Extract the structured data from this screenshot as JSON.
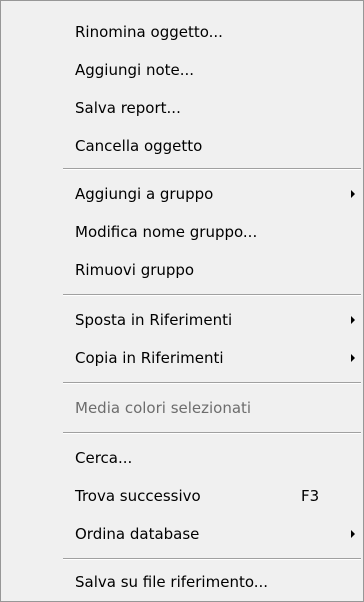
{
  "menu": {
    "items": [
      {
        "label": "Rinomina oggetto..."
      },
      {
        "label": "Aggiungi note..."
      },
      {
        "label": "Salva report..."
      },
      {
        "label": "Cancella oggetto"
      },
      {
        "label": "Aggiungi a gruppo",
        "submenu": true
      },
      {
        "label": "Modifica nome gruppo..."
      },
      {
        "label": "Rimuovi gruppo"
      },
      {
        "label": "Sposta in Riferimenti",
        "submenu": true
      },
      {
        "label": "Copia in Riferimenti",
        "submenu": true
      },
      {
        "label": "Media colori selezionati",
        "disabled": true
      },
      {
        "label": "Cerca..."
      },
      {
        "label": "Trova successivo",
        "shortcut": "F3"
      },
      {
        "label": "Ordina database",
        "submenu": true
      },
      {
        "label": "Salva su file riferimento..."
      }
    ]
  }
}
